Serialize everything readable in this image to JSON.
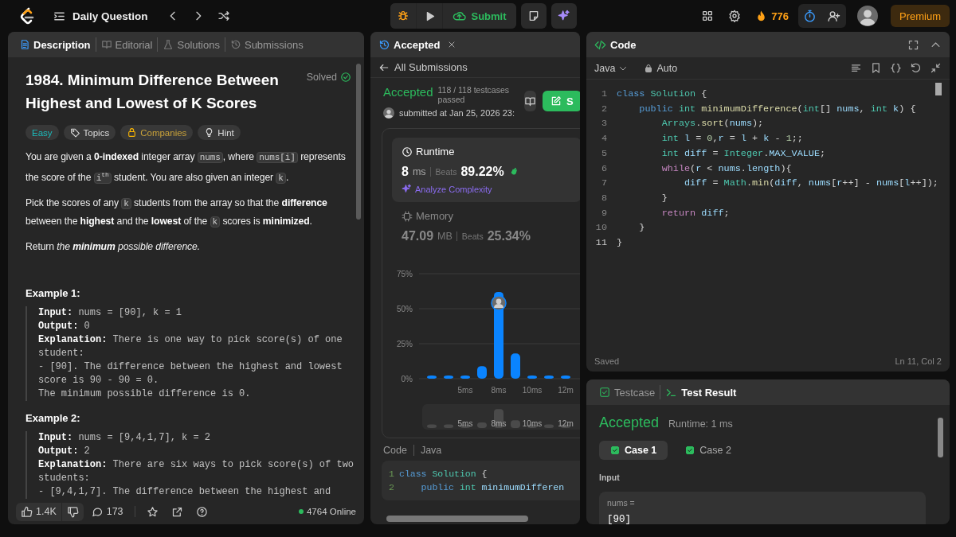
{
  "top_bar": {
    "title": "Daily Question",
    "submit": "Submit",
    "streak": "776",
    "premium": "Premium"
  },
  "description": {
    "tabs": [
      {
        "label": "Description",
        "kind": "description",
        "selected": true
      },
      {
        "label": "Editorial",
        "kind": "editorial",
        "selected": false
      },
      {
        "label": "Solutions",
        "kind": "solutions",
        "selected": false
      },
      {
        "label": "Submissions",
        "kind": "submissions",
        "selected": false
      }
    ],
    "title": "1984. Minimum Difference Between Highest and Lowest of K Scores",
    "status": "Solved",
    "tags": [
      {
        "label": "Easy",
        "kind": "difficulty"
      },
      {
        "label": "Topics",
        "kind": "topics"
      },
      {
        "label": "Companies",
        "kind": "companies"
      },
      {
        "label": "Hint",
        "kind": "hint"
      }
    ],
    "paragraphs": [
      [
        {
          "kind": "text",
          "text": "You are given a **0-indexed** integer array "
        },
        {
          "kind": "code",
          "text": "nums"
        },
        {
          "kind": "text",
          "text": ", where "
        },
        {
          "kind": "code",
          "text": "nums[i]"
        },
        {
          "kind": "text",
          "text": " represents the score of the "
        },
        {
          "kind": "code",
          "text": "i$^{th}$"
        },
        {
          "kind": "text",
          "text": " student. You are also given an integer "
        },
        {
          "kind": "code",
          "text": "k"
        },
        {
          "kind": "text",
          "text": "."
        }
      ],
      [
        {
          "kind": "text",
          "text": "Pick the scores of any "
        },
        {
          "kind": "code",
          "text": "k"
        },
        {
          "kind": "text",
          "text": " students from the array so that the **difference** between the **highest** and the **lowest** of the "
        },
        {
          "kind": "code",
          "text": "k"
        },
        {
          "kind": "text",
          "text": " scores is **minimized**."
        }
      ],
      [
        {
          "kind": "text",
          "text": "Return *the* **minimum** *possible difference.*"
        }
      ]
    ],
    "examples": [
      {
        "heading": "Example 1:",
        "lines": [
          "**Input:** nums = [90], k = 1",
          "**Output:** 0",
          "**Explanation:** There is one way to pick score(s) of one student:\n- [90]. The difference between the highest and lowest score is 90 - 90 = 0.\nThe minimum possible difference is 0."
        ]
      },
      {
        "heading": "Example 2:",
        "lines": [
          "**Input:** nums = [9,4,1,7], k = 2",
          "**Output:** 2",
          "**Explanation:** There are six ways to pick score(s) of two students:\n- [9,4,1,7]. The difference between the highest and"
        ]
      }
    ],
    "footer": {
      "likes": "1.4K",
      "comments": "173",
      "online": "4764 Online"
    }
  },
  "submission": {
    "tab": "Accepted",
    "back": "All Submissions",
    "status": "Accepted",
    "testcases": "118 / 118 testcases passed",
    "solution_button": "S",
    "submitted": "submitted at Jan 25, 2026 23:",
    "metrics": [
      {
        "kind": "runtime",
        "label": "Runtime",
        "selected": true,
        "value": "8",
        "unit": "ms",
        "beats_label": "Beats",
        "beats": "89.22%",
        "action": "Analyze Complexity"
      },
      {
        "kind": "memory",
        "label": "Memory",
        "selected": false,
        "value": "47.09",
        "unit": "MB",
        "beats_label": "Beats",
        "beats": "25.34%"
      }
    ],
    "chart_data": {
      "type": "bar",
      "categories": [
        null,
        null,
        "5ms",
        null,
        "8ms",
        null,
        "10ms",
        null,
        "12m"
      ],
      "values": [
        1.5,
        1.5,
        1.5,
        9,
        62,
        18,
        1.5,
        1.5,
        1.5
      ],
      "ylim": [
        0,
        75
      ],
      "yticks": [
        {
          "value": 0,
          "label": "0%"
        },
        {
          "value": 25,
          "label": "25%"
        },
        {
          "value": 50,
          "label": "50%"
        },
        {
          "value": 75,
          "label": "75%"
        }
      ]
    },
    "navigator_labels": [
      "5ms",
      "8ms",
      "10ms",
      "12m"
    ],
    "code_label": "Code",
    "language": "Java",
    "code": [
      {
        "number": "1",
        "text": "class Solution {"
      },
      {
        "number": "2",
        "text": "    public int minimumDifferen"
      }
    ]
  },
  "editor": {
    "title": "Code",
    "language": "Java",
    "mode": "Auto",
    "lines": [
      {
        "number": "1",
        "text": "class Solution {"
      },
      {
        "number": "2",
        "text": "    public int minimumDifference(int[] nums, int k) {"
      },
      {
        "number": "3",
        "text": "        Arrays.sort(nums);"
      },
      {
        "number": "4",
        "text": "        int l = 0,r = l + k - 1;;"
      },
      {
        "number": "5",
        "text": "        int diff = Integer.MAX_VALUE;"
      },
      {
        "number": "6",
        "text": "        while(r < nums.length){"
      },
      {
        "number": "7",
        "text": "            diff = Math.min(diff, nums[r++] - nums[l++]);"
      },
      {
        "number": "8",
        "text": "        }"
      },
      {
        "number": "9",
        "text": "        return diff;"
      },
      {
        "number": "10",
        "text": "    }"
      },
      {
        "number": "11",
        "text": "}"
      }
    ],
    "status": "Saved",
    "cursor": "Ln 11, Col 2"
  },
  "test": {
    "tabs": [
      {
        "label": "Testcase",
        "kind": "testcase",
        "selected": false
      },
      {
        "label": "Test Result",
        "kind": "result",
        "selected": true
      }
    ],
    "status": "Accepted",
    "runtime": "Runtime: 1 ms",
    "cases": [
      {
        "label": "Case 1",
        "selected": true
      },
      {
        "label": "Case 2",
        "selected": false
      }
    ],
    "input_label": "Input",
    "variable": "nums =",
    "value": "[90]"
  }
}
